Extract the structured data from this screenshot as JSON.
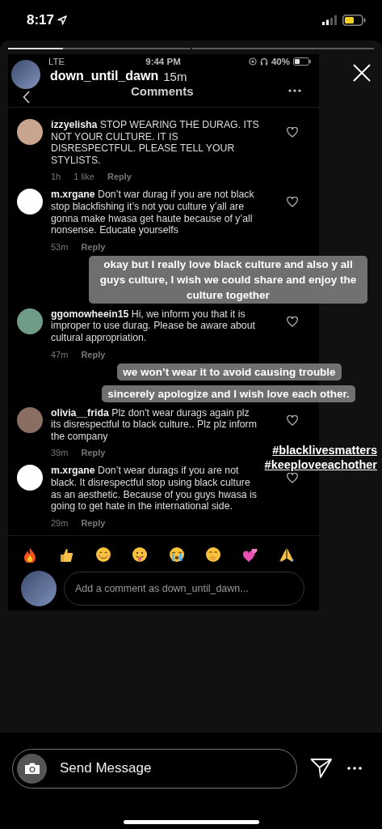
{
  "status_bar": {
    "time": "8:17"
  },
  "story": {
    "progress": [
      {
        "level": 0.3
      },
      {
        "level": 0
      }
    ],
    "header": {
      "username": "down_until_dawn",
      "age": "15m"
    },
    "screenshot": {
      "status": {
        "carrier": "LTE",
        "time": "9:44 PM",
        "battery": "40%"
      },
      "title": "Comments",
      "comments": [
        {
          "username": "izzyelisha",
          "text": "STOP WEARING THE DURAG. ITS NOT YOUR CULTURE. IT IS DISRESPECTFUL. PLEASE TELL YOUR STYLISTS.",
          "time": "1h",
          "likes": "1 like",
          "reply": "Reply",
          "color": "#c9a48e"
        },
        {
          "username": "m.xrgane",
          "text": "Don’t war durag if you are not black stop blackfishing it’s not you culture y’all are gonna make hwasa get haute because of y’all nonsense. Educate yourselfs",
          "time": "53m",
          "reply": "Reply",
          "color": "#ffffff"
        },
        {
          "username": "ggomowheein15",
          "text": "Hi, we inform you that it is improper to use durag. Please be aware about cultural appropriation.",
          "time": "47m",
          "reply": "Reply",
          "color": "#6f9c86"
        },
        {
          "username": "olivia__frida",
          "text": "Plz don't wear durags again plz its disrespectful to black culture.. Plz plz inform the company",
          "time": "39m",
          "reply": "Reply",
          "color": "#8a6e62"
        },
        {
          "username": "m.xrgane",
          "text": "Don’t wear durags if you are not black. It disrespectful stop using black culture as an aesthetic. Because of you guys hwasa is going to get hate in the international side.",
          "time": "29m",
          "reply": "Reply",
          "color": "#ffffff"
        }
      ],
      "composer": {
        "placeholder": "Add a comment as down_until_dawn..."
      }
    },
    "captions": [
      "okay but I really love black culture and also y all guys culture, I wish we could share and enjoy the culture together",
      "we won’t wear it to avoid causing trouble",
      "sincerely apologize and I wish love each other."
    ],
    "hashtags": [
      "#blacklivesmatters",
      "#keeploveeachother"
    ]
  },
  "reply_bar": {
    "placeholder": "Send Message"
  }
}
